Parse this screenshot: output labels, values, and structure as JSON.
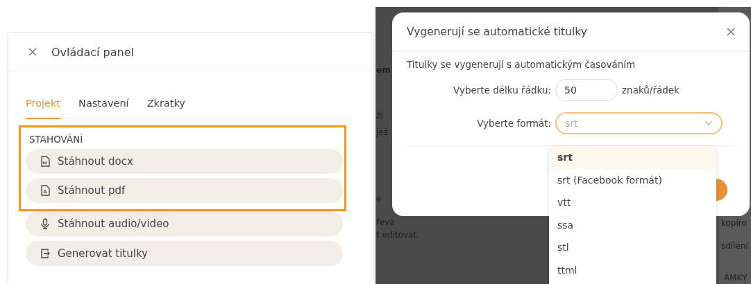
{
  "control_panel": {
    "title": "Ovládací panel",
    "tabs": [
      {
        "label": "Projekt",
        "selected": true
      },
      {
        "label": "Nastavení",
        "selected": false
      },
      {
        "label": "Zkratky",
        "selected": false
      }
    ],
    "section_title": "STAHOVÁNÍ",
    "actions": [
      {
        "label": "Stáhnout docx",
        "kind": "docx",
        "highlighted": true
      },
      {
        "label": "Stáhnout pdf",
        "kind": "pdf",
        "highlighted": true
      },
      {
        "label": "Stáhnout audio/video",
        "kind": "audio",
        "highlighted": false
      },
      {
        "label": "Generovat titulky",
        "kind": "subtitles",
        "highlighted": false
      }
    ]
  },
  "background_page": {
    "texts": [
      {
        "text": "em",
        "kind": "heading"
      },
      {
        "text": "ží",
        "kind": "body"
      },
      {
        "text": "ješ",
        "kind": "body"
      },
      {
        "text": "e",
        "kind": "body"
      },
      {
        "text": "řeva",
        "kind": "body"
      },
      {
        "text": "t editovat.",
        "kind": "body"
      },
      {
        "text": "kopíro",
        "kind": "side"
      },
      {
        "text": "sdílení",
        "kind": "side"
      },
      {
        "text": "ÁMKY",
        "kind": "side"
      }
    ]
  },
  "dialog": {
    "title": "Vygenerují se automatické titulky",
    "description": "Titulky se vygenerují s automatickým časováním",
    "line_length": {
      "label": "Vyberte délku řádku:",
      "value": "50",
      "unit": "znaků/řádek"
    },
    "format": {
      "label": "Vyberte formát:",
      "placeholder": "srt",
      "focused": true,
      "options": [
        {
          "label": "srt",
          "selected": true
        },
        {
          "label": "srt (Facebook formát)",
          "selected": false
        },
        {
          "label": "vtt",
          "selected": false
        },
        {
          "label": "ssa",
          "selected": false
        },
        {
          "label": "stl",
          "selected": false
        },
        {
          "label": "ttml",
          "selected": false
        }
      ]
    }
  }
}
